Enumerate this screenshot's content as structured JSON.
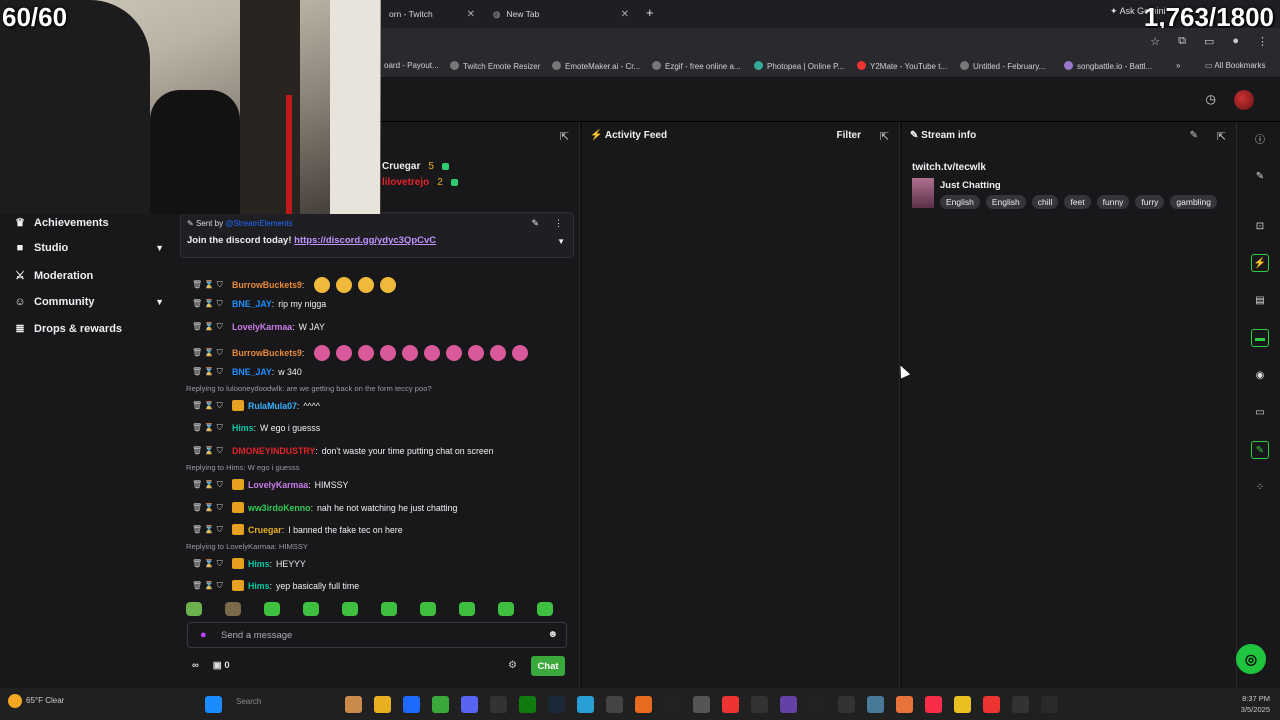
{
  "overlay": {
    "fps": "60/60",
    "counter": "1,763/1800"
  },
  "browser": {
    "tabs": [
      {
        "label": "orn - Twitch"
      },
      {
        "label": "New Tab"
      }
    ],
    "gemini": "Ask Gemini",
    "bookmarks": [
      "oard - Payout...",
      "Twitch Emote Resizer",
      "EmoteMaker.ai - Cr...",
      "Ezgif - free online a...",
      "Photopea | Online P...",
      "Y2Mate - YouTube t...",
      "Untitled - February...",
      "songbattle.io - Battl...",
      "All Bookmarks"
    ]
  },
  "sidebar": {
    "items": [
      {
        "label": "Achievements",
        "icon": "trophy-icon"
      },
      {
        "label": "Studio",
        "icon": "studio-icon",
        "expand": true
      },
      {
        "label": "Moderation",
        "icon": "sword-icon"
      },
      {
        "label": "Community",
        "icon": "people-icon",
        "expand": true
      },
      {
        "label": "Drops & rewards",
        "icon": "gift-icon"
      }
    ]
  },
  "chat": {
    "top_bits": [
      {
        "user": "Cruegar",
        "count": "5"
      },
      {
        "user": "lilovetrejo",
        "count": "2"
      }
    ],
    "pinned": {
      "sent_by": "Sent by",
      "sender": "@StreamElements",
      "message": "Join the discord today! ",
      "link": "https://discord.gg/ydyc3QpCvC"
    },
    "messages": [
      {
        "user": "BurrowBuckets9",
        "color": "#e88a3a",
        "text": "",
        "emotes": 4,
        "emote_color": "#f0b93a"
      },
      {
        "user": "BNE_JAY",
        "color": "#1e90ff",
        "text": "rip my nigga",
        "emotes": 0
      },
      {
        "user": "LovelyKarmaa",
        "color": "#c97be8",
        "text": "W JAY",
        "emotes": 0
      },
      {
        "user": "BurrowBuckets9",
        "color": "#e88a3a",
        "text": "",
        "emotes": 10,
        "emote_color": "#d85a9a"
      },
      {
        "user": "BNE_JAY",
        "color": "#1e90ff",
        "text": "w 340",
        "emotes": 0
      },
      {
        "user": "RulaMula07",
        "color": "#3ab0ff",
        "text": "^^^^",
        "emotes": 0
      },
      {
        "user": "Hims",
        "color": "#00c8a0",
        "text": "W ego i guesss",
        "emotes": 0
      },
      {
        "user": "DMONEYINDUSTRY",
        "color": "#e0242a",
        "text": "don't waste your time putting chat on screen",
        "emotes": 0
      },
      {
        "user": "LovelyKarmaa",
        "color": "#c97be8",
        "text": "HIMSSY",
        "emotes": 0
      },
      {
        "user": "ww3irdoKenno",
        "color": "#33cc55",
        "text": "nah he not watching he just chatting",
        "emotes": 0
      },
      {
        "user": "Cruegar",
        "color": "#e8b020",
        "text": "I banned the fake tec on here",
        "emotes": 0
      },
      {
        "user": "Hims",
        "color": "#00c8a0",
        "text": "HEYYY",
        "emotes": 0
      },
      {
        "user": "Hims",
        "color": "#00c8a0",
        "text": "yep basically full time",
        "emotes": 0
      }
    ],
    "replies": [
      "Replying to lulooneydoodwlk: are we getting back on the form teccy poo?",
      "Replying to Hims: W ego i guesss",
      "Replying to LovelyKarmaa: HIMSSY"
    ],
    "input_placeholder": "Send a message",
    "points": "0",
    "chat_button": "Chat"
  },
  "activity": {
    "title": "Activity Feed",
    "filter": "Filter"
  },
  "stream_info": {
    "title": "Stream info",
    "url": "twitch.tv/tecwlk",
    "category": "Just Chatting",
    "tags": [
      "English",
      "English",
      "chill",
      "feet",
      "funny",
      "furry",
      "gambling"
    ]
  },
  "taskbar": {
    "weather": "65°F Clear",
    "search": "Search",
    "time": "8:37 PM",
    "date": "3/5/2025"
  }
}
